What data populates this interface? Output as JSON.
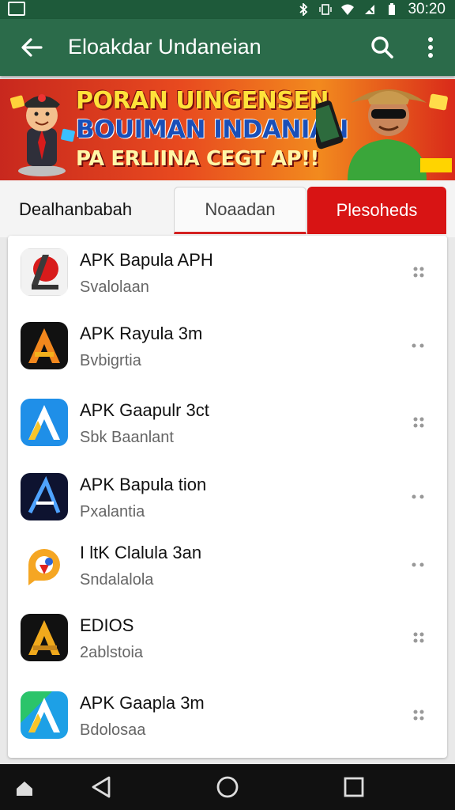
{
  "status_bar": {
    "time": "30:20"
  },
  "app_bar": {
    "title": "Eloakdar Undaneian"
  },
  "banner": {
    "line1": "PORAN UINGENSEN",
    "line2": "BOUIMAN INDANIAN",
    "line3": "PA ERLIINA CEGT AP!!"
  },
  "tabs_row": {
    "category_label": "Dealhanbabah",
    "tab_inactive": "Noaadan",
    "tab_active": "Plesoheds"
  },
  "apps": [
    {
      "name": "APK Bapula APH",
      "sub": "Svalolaan",
      "icon": "p-logo-icon"
    },
    {
      "name": "APK Rayula 3m",
      "sub": "Bvbigrtia",
      "icon": "a-orange-icon"
    },
    {
      "name": "APK Gaapulr 3ct",
      "sub": "Sbk Baanlant",
      "icon": "a-blue-icon"
    },
    {
      "name": "APK Bapula tion",
      "sub": "Pxalantia",
      "icon": "a-dark-icon"
    },
    {
      "name": "I ltK Clalula 3an",
      "sub": "Sndalalola",
      "icon": "p-orange-icon"
    },
    {
      "name": "EDIOS",
      "sub": "2ablstoia",
      "icon": "a-black-gold-icon"
    },
    {
      "name": "APK Gaapla 3m",
      "sub": "Bdolosaa",
      "icon": "a-green-blue-icon"
    }
  ],
  "colors": {
    "status_bar": "#1e5a3a",
    "app_bar": "#2b6b4a",
    "active_tab": "#d81414",
    "nav_bar": "#111111"
  }
}
